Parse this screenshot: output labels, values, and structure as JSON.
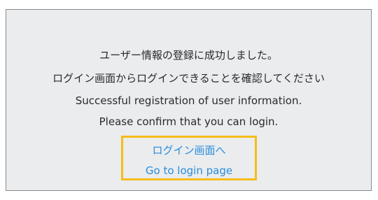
{
  "message": {
    "line1": "ユーザー情報の登録に成功しました。",
    "line2": "ログイン画面からログインできることを確認してください",
    "line3": "Successful registration of user information.",
    "line4": "Please confirm that you can login."
  },
  "login_link": {
    "label_jp": "ログイン画面へ",
    "label_en": "Go to login page"
  },
  "colors": {
    "link": "#2a8ddb",
    "highlight_border": "#f6bd19",
    "panel_background": "#eaecee",
    "panel_border": "#8a8a8a"
  }
}
